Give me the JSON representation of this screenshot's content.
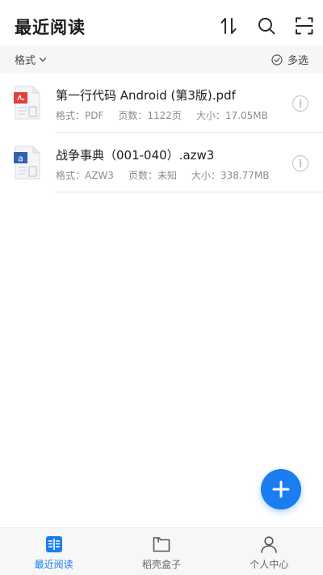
{
  "header": {
    "title": "最近阅读",
    "icons": [
      "sort-icon",
      "search-icon",
      "scan-icon"
    ]
  },
  "filter": {
    "format_label": "格式",
    "multi_select_label": "多选"
  },
  "files": [
    {
      "name": "第一行代码 Android (第3版).pdf",
      "type_icon": "pdf-file-icon",
      "format": "格式：PDF",
      "pages": "页数：1122页",
      "size": "大小：17.05MB"
    },
    {
      "name": "战争事典（001-040）.azw3",
      "type_icon": "azw3-file-icon",
      "format": "格式：AZW3",
      "pages": "页数：未知",
      "size": "大小：338.77MB"
    }
  ],
  "bottom_nav": {
    "items": [
      {
        "label": "最近阅读",
        "icon": "book-icon",
        "active": true
      },
      {
        "label": "稻壳盒子",
        "icon": "folder-icon",
        "active": false
      },
      {
        "label": "个人中心",
        "icon": "person-icon",
        "active": false
      }
    ]
  },
  "colors": {
    "accent": "#1a7df0",
    "pdf_red": "#e0403e",
    "azw3_blue": "#2f62b0",
    "muted_text": "#8c8c8c"
  }
}
